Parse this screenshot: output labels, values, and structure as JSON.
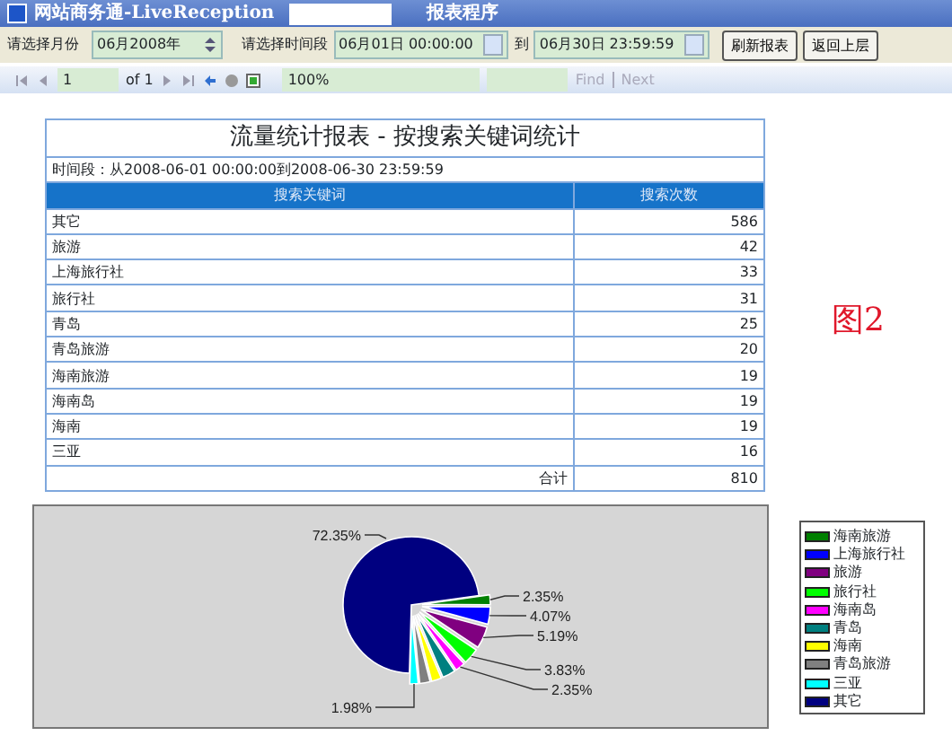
{
  "window": {
    "title": "网站商务通-LiveReception",
    "subtitle": "报表程序"
  },
  "filters": {
    "month_label": "请选择月份",
    "month_value": "06月2008年",
    "range_label": "请选择时间段",
    "range_from": "06月01日 00:00:00",
    "range_to_label": "到",
    "range_to": "06月30日 23:59:59",
    "buttons": [
      "刷新报表",
      "返回上层"
    ]
  },
  "report_toolbar": {
    "page": "1",
    "page_count": "of 1",
    "zoom": "100%",
    "find_label": "Find",
    "next_label": "Next",
    "find_disabled": true
  },
  "report": {
    "title": "流量统计报表 - 按搜索关键词统计",
    "period": "时间段：从2008-06-01 00:00:00到2008-06-30 23:59:59",
    "columns": [
      "搜索关键词",
      "搜索次数"
    ],
    "rows": [
      [
        "其它",
        "586"
      ],
      [
        "旅游",
        "42"
      ],
      [
        "上海旅行社",
        "33"
      ],
      [
        "旅行社",
        "31"
      ],
      [
        "青岛",
        "25"
      ],
      [
        "青岛旅游",
        "20"
      ],
      [
        "海南旅游",
        "19"
      ],
      [
        "海南岛",
        "19"
      ],
      [
        "海南",
        "19"
      ],
      [
        "三亚",
        "16"
      ]
    ],
    "total_label": "合计",
    "total_value": "810"
  },
  "figure_label": "图2",
  "chart": {
    "chart_data": {
      "type": "pie",
      "categories": [
        "海南旅游",
        "上海旅行社",
        "旅游",
        "旅行社",
        "海南岛",
        "青岛",
        "海南",
        "青岛旅游",
        "三亚",
        "其它"
      ],
      "values": [
        2.35,
        4.07,
        5.19,
        3.83,
        2.35,
        3.09,
        2.35,
        2.47,
        1.98,
        72.35
      ],
      "colors": [
        "#008000",
        "#0000ff",
        "#800080",
        "#00ff00",
        "#ff00ff",
        "#008080",
        "#ffff00",
        "#808080",
        "#00ffff",
        "#000080"
      ],
      "value_labels": [
        "2.35%",
        "4.07%",
        "5.19%",
        "3.83%",
        "2.35%",
        null,
        null,
        null,
        "1.98%",
        "72.35%"
      ]
    }
  }
}
